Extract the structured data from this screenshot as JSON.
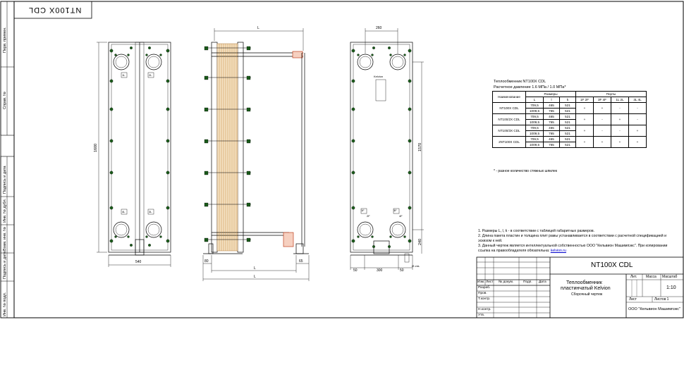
{
  "sheet": {
    "stamp_code": "NT100X CDL",
    "side_labels": [
      "Перв. примен.",
      "Справ. №",
      "Подпись и дата",
      "Инв. № дубл.",
      "Взам. инв. №",
      "Подпись и дата",
      "Инв. № подл."
    ]
  },
  "front_view": {
    "dim_height": "1600",
    "dim_width": "540",
    "port_labels": [
      "1L",
      "2L",
      "4L",
      "3L"
    ]
  },
  "side_view": {
    "dim_top": "L",
    "dim_left_bottom": "80",
    "dim_right_bottom": "65",
    "dim_bottom_1": "L",
    "dim_bottom_2": "L"
  },
  "rear_view": {
    "dim_top": "260",
    "dim_height": "1570",
    "dim_port_offset": "240",
    "dim_bottom_left": "50",
    "dim_bottom_mid": "300",
    "dim_bottom_right": "50",
    "dim_bottom_note": "Ø отв.",
    "brand_label": "Kelvion",
    "port_labels": [
      "1F",
      "2F",
      "3F",
      "4F"
    ]
  },
  "spec_table": {
    "title": "Теплообменник NT100X CDL",
    "subtitle": "Расчетное давление 1.6 МПа / 1.0 МПа*",
    "headers": {
      "name": "Наименование",
      "dims": "Размеры",
      "ports": "Порты",
      "L": "L",
      "l": "l",
      "k": "k",
      "p1": "1F 2F",
      "p2": "3F 4F",
      "p3": "1L 2L",
      "p4": "3L 4L"
    },
    "rows": [
      {
        "name": "NT100X CDL",
        "L": [
          "709,5",
          "1009,5"
        ],
        "l": [
          "465",
          "765"
        ],
        "k": [
          "521",
          "521"
        ],
        "ports": [
          "+",
          "+",
          "-",
          "-"
        ]
      },
      {
        "name": "NT100/2X CDL",
        "L": [
          "709,5",
          "1009,5"
        ],
        "l": [
          "465",
          "765"
        ],
        "k": [
          "521",
          "521"
        ],
        "ports": [
          "+",
          "-",
          "+",
          "-"
        ]
      },
      {
        "name": "NT100/3X CDL",
        "L": [
          "709,5",
          "1009,5"
        ],
        "l": [
          "465",
          "765"
        ],
        "k": [
          "521",
          "521"
        ],
        "ports": [
          "+",
          "-",
          "-",
          "+"
        ]
      },
      {
        "name": "2NT100X CDL",
        "L": [
          "709,5",
          "1009,5"
        ],
        "l": [
          "465",
          "765"
        ],
        "k": [
          "521",
          "521"
        ],
        "ports": [
          "+",
          "+",
          "+",
          "+"
        ]
      }
    ],
    "footnote": "* - разное количество стяжных шпилек"
  },
  "notes": [
    "1. Размеры L, l, k - в соответствии с таблицей габаритных размеров.",
    "2. Длина пакета пластин и толщина плит рамы устанавливается в соответствии с расчетной спецификацией и",
    "    эскизом к ней.",
    "3. Данный чертеж является интеллектуальной собственностью ООО \"Кельвион Машимпэкс\". При копировании",
    "    ссылка на правообладателя обязательна: "
  ],
  "notes_link": "kelvion.ru",
  "title_block": {
    "designation": "NT100X CDL",
    "name_line1": "Теплообменник",
    "name_line2": "пластинчатый Kelvion",
    "name_line3": "Сборочный чертеж",
    "lit_label": "Лит.",
    "mass_label": "Масса",
    "scale_label": "Масштаб",
    "scale_value": "1:10",
    "sheet_label": "Лист",
    "sheets_label": "Листов 1",
    "company": "ООО \"Кельвион Машимпэкс\"",
    "col_headers": [
      "Изм.",
      "Лист",
      "№ докум.",
      "Подп.",
      "Дата"
    ],
    "roles": [
      "Разраб.",
      "Пров.",
      "Т.контр.",
      "",
      "Н.контр.",
      "Утв."
    ]
  }
}
